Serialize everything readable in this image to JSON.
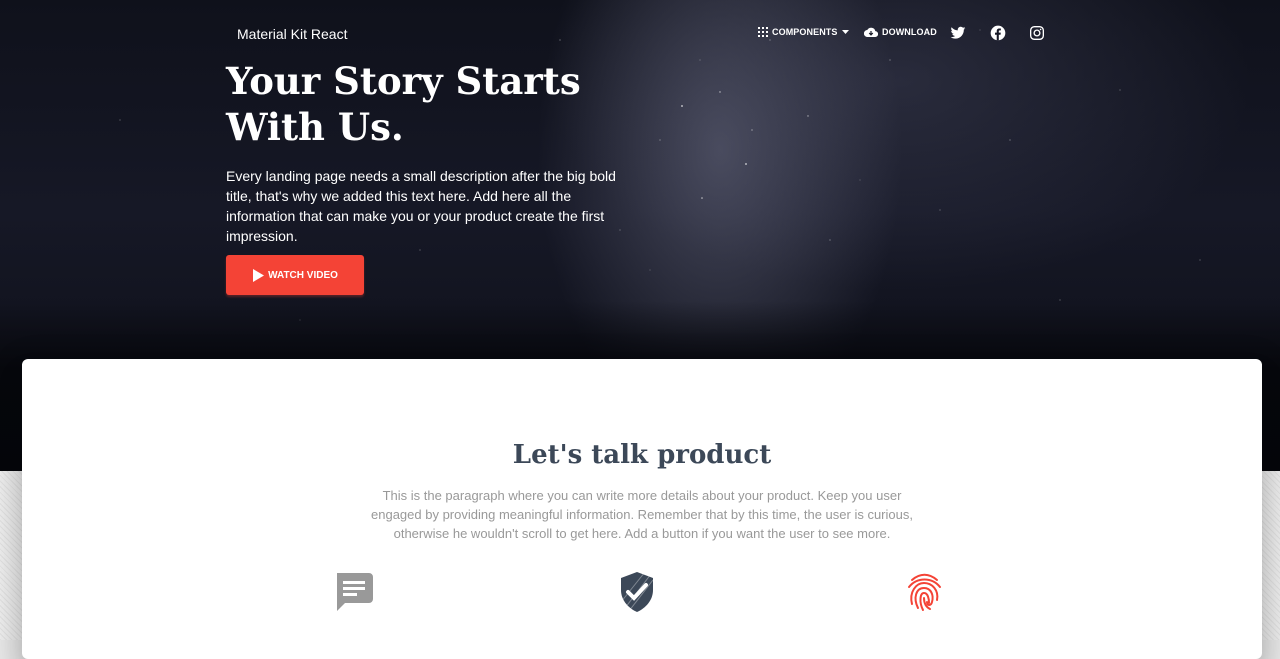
{
  "nav": {
    "brand": "Material Kit React",
    "components_label": "COMPONENTS",
    "download_label": "DOWNLOAD",
    "social_icons": [
      "twitter-icon",
      "facebook-icon",
      "instagram-icon"
    ]
  },
  "hero": {
    "title": "Your Story Starts With Us.",
    "description": "Every landing page needs a small description after the big bold title, that's why we added this text here. Add here all the information that can make you or your product create the first impression.",
    "button_label": "WATCH VIDEO",
    "button_color": "#f44336"
  },
  "product": {
    "title": "Let's talk product",
    "description": "This is the paragraph where you can write more details about your product. Keep you user engaged by providing meaningful information. Remember that by this time, the user is curious, otherwise he wouldn't scroll to get here. Add a button if you want the user to see more.",
    "features": [
      {
        "icon": "chat-icon",
        "color": "#999999"
      },
      {
        "icon": "verified-user-icon",
        "color": "#3c4858"
      },
      {
        "icon": "fingerprint-icon",
        "color": "#f44336"
      }
    ]
  }
}
